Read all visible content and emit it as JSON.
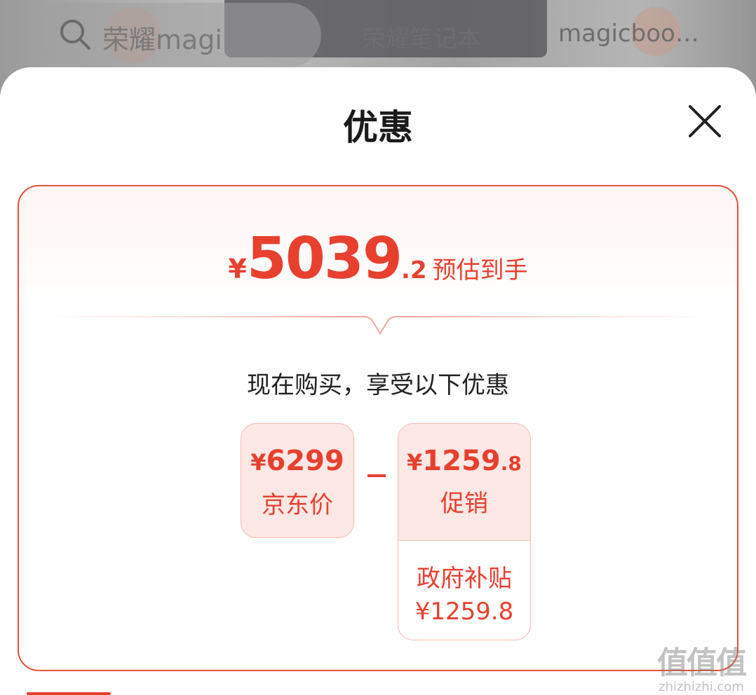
{
  "background": {
    "search_text": "荣耀magi",
    "title": "荣耀笔记本",
    "title2": "magicboo…"
  },
  "sheet": {
    "title": "优惠",
    "close_icon": "close-icon"
  },
  "summary": {
    "currency": "¥",
    "integer": "5039",
    "decimal": ".2",
    "label": "预估到手"
  },
  "benefits_heading": "现在购买，享受以下优惠",
  "jd_price": {
    "currency": "¥",
    "amount": "6299",
    "label": "京东价"
  },
  "operator": "-",
  "promotion": {
    "currency": "¥",
    "integer": "1259",
    "decimal": ".8",
    "label": "促销",
    "detail_label": "政府补贴",
    "detail_amount": "¥1259.8"
  },
  "watermark": {
    "main": "值值值",
    "sub": "zhizhizhi.com"
  },
  "colors": {
    "accent": "#e8402f",
    "accent_light_bg": "#fde8e6",
    "border": "#e8503a"
  }
}
